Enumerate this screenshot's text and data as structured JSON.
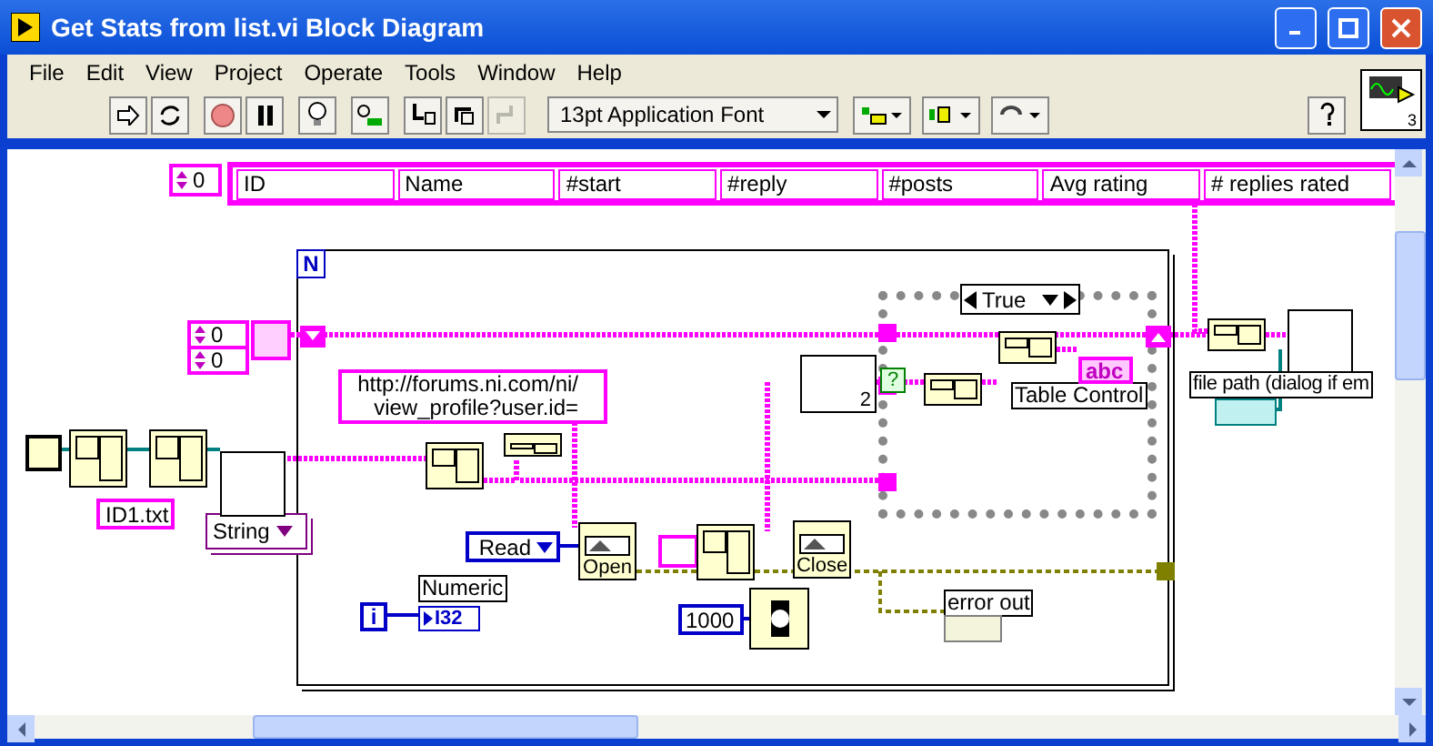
{
  "window": {
    "title": "Get Stats from list.vi Block Diagram"
  },
  "menu": [
    "File",
    "Edit",
    "View",
    "Project",
    "Operate",
    "Tools",
    "Window",
    "Help"
  ],
  "toolbar": {
    "font": "13pt Application Font",
    "connector_count": "3"
  },
  "diagram": {
    "cluster_constant": {
      "index": "0",
      "fields": [
        "ID",
        "Name",
        "#start",
        "#reply",
        "#posts",
        "Avg rating",
        "# replies rated"
      ]
    },
    "for_loop": {
      "count": "N",
      "iteration": "i"
    },
    "array_constant": {
      "indices": [
        "0",
        "0"
      ]
    },
    "url_constant": {
      "lines": [
        "http://forums.ni.com/ni/",
        "view_profile?user.id="
      ]
    },
    "case_structure": {
      "selector": "True"
    },
    "nodes": [
      {
        "kind": "string",
        "text": "ID1.txt"
      },
      {
        "kind": "ring",
        "text": "String"
      },
      {
        "kind": "enum",
        "text": "Read"
      },
      {
        "kind": "function",
        "text": "Open"
      },
      {
        "kind": "function",
        "text": "Close"
      },
      {
        "kind": "label",
        "text": "Numeric"
      },
      {
        "kind": "terminal",
        "text": "I32"
      },
      {
        "kind": "numeric",
        "text": "1000"
      },
      {
        "kind": "label",
        "text": "error out"
      },
      {
        "kind": "label",
        "text": "Table Control"
      },
      {
        "kind": "terminal",
        "text": "abc"
      },
      {
        "kind": "label",
        "text": "file path (dialog if em"
      },
      {
        "kind": "subvi",
        "text": "2"
      },
      {
        "kind": "selector",
        "text": "?"
      }
    ]
  }
}
